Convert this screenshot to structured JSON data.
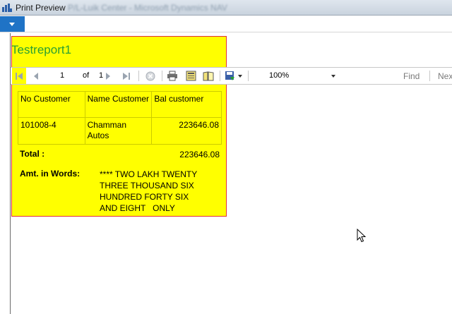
{
  "window": {
    "title": "Print Preview",
    "title_suffix_blurred": "P/L-Luik Center - Microsoft Dynamics NAV"
  },
  "report": {
    "title": "Testreport1"
  },
  "toolbar": {
    "current_page": "1",
    "of_label": "of",
    "total_pages": "1",
    "zoom_value": "100%",
    "find_label": "Find",
    "next_label": "Next"
  },
  "table": {
    "headers": [
      "No Customer",
      "Name Customer",
      "Bal customer"
    ],
    "rows": [
      [
        "101008-4",
        "Chamman Autos",
        "223646.08"
      ]
    ]
  },
  "totals": {
    "label": "Total :",
    "value": "223646.08"
  },
  "amount_words": {
    "label": "Amt. in Words:",
    "line1": "**** TWO LAKH TWENTY",
    "line2": "THREE THOUSAND SIX",
    "line3": "HUNDRED FORTY SIX",
    "line4": "AND EIGHT   ONLY"
  },
  "colors": {
    "report_background": "#ffff00",
    "report_border": "#e0303a",
    "title_green": "#2aa033",
    "menu_blue": "#1f73c6"
  },
  "icons": [
    "app-icon",
    "first-page-icon",
    "previous-page-icon",
    "next-page-icon",
    "last-page-icon",
    "stop-icon",
    "print-icon",
    "page-setup-icon",
    "print-layout-icon",
    "export-icon",
    "chevron-down-icon",
    "mouse-pointer-icon"
  ]
}
